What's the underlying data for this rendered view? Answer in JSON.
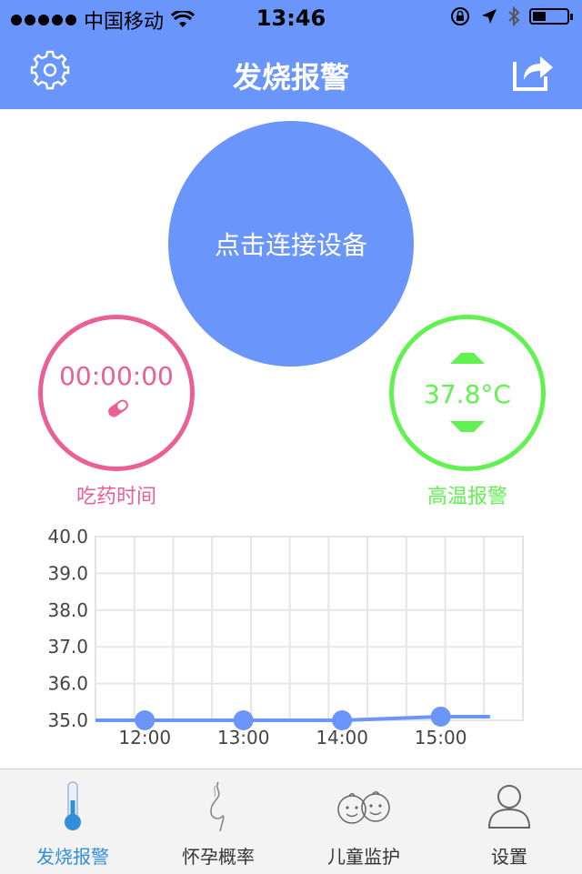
{
  "status_bar": {
    "carrier": "中国移动",
    "time": "13:46"
  },
  "nav": {
    "title": "发烧报警",
    "settings_icon": "gear-icon",
    "share_icon": "share-icon"
  },
  "main": {
    "connect_label": "点击连接设备",
    "medicine": {
      "time": "00:00:00",
      "label": "吃药时间",
      "color": "#ea5f96",
      "icon": "pill-icon"
    },
    "temperature": {
      "value": "37.8°C",
      "label": "高温报警",
      "color": "#61f151"
    }
  },
  "chart_data": {
    "type": "line",
    "y_ticks": [
      "40.0",
      "39.0",
      "38.0",
      "37.0",
      "36.0",
      "35.0"
    ],
    "ylim": [
      35.0,
      40.0
    ],
    "x_ticks": [
      "12:00",
      "13:00",
      "14:00",
      "15:00"
    ],
    "series": [
      {
        "x": [
          "11:30",
          "12:00",
          "13:00",
          "14:00",
          "15:00",
          "15:30"
        ],
        "values": [
          35.0,
          35.0,
          35.0,
          35.0,
          35.1,
          35.1
        ],
        "markers": [
          false,
          true,
          true,
          true,
          true,
          false
        ]
      }
    ],
    "line_color": "#6a96fb",
    "grid": true
  },
  "tab_bar": {
    "tabs": [
      {
        "label": "发烧报警",
        "icon": "thermometer-icon",
        "active": true
      },
      {
        "label": "怀孕概率",
        "icon": "pregnancy-icon",
        "active": false
      },
      {
        "label": "儿童监护",
        "icon": "children-icon",
        "active": false
      },
      {
        "label": "设置",
        "icon": "user-icon",
        "active": false
      }
    ],
    "active_color": "#2f8fd8"
  }
}
